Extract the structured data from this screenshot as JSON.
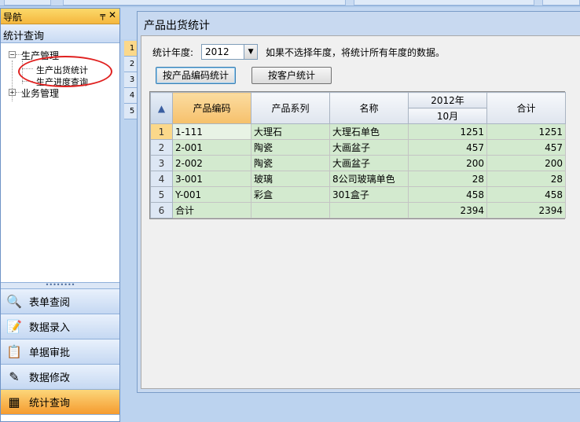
{
  "nav": {
    "title": "导航",
    "pin_icon": "pin-icon",
    "close_icon": "close-icon",
    "section": "统计查询",
    "tree": [
      {
        "label": "生产管理",
        "expanded": true,
        "children": [
          "生产出货统计",
          "生产进度查询"
        ]
      },
      {
        "label": "业务管理",
        "expanded": false,
        "children": []
      }
    ],
    "buttons": [
      {
        "label": "表单查阅",
        "icon": "search-doc-icon"
      },
      {
        "label": "数据录入",
        "icon": "data-entry-icon"
      },
      {
        "label": "单据审批",
        "icon": "approve-icon"
      },
      {
        "label": "数据修改",
        "icon": "edit-icon"
      },
      {
        "label": "统计查询",
        "icon": "table-icon",
        "active": true
      }
    ]
  },
  "background_rows": [
    "1",
    "2",
    "3",
    "4",
    "5"
  ],
  "dialog": {
    "title": "产品出货统计",
    "year_label": "统计年度:",
    "year_value": "2012",
    "hint": "如果不选择年度，将统计所有年度的数据。",
    "btn_by_code": "按产品编码统计",
    "btn_by_customer": "按客户统计"
  },
  "table": {
    "headers": {
      "code": "产品编码",
      "series": "产品系列",
      "name": "名称",
      "year_group": "2012年",
      "month": "10月",
      "total": "合计"
    },
    "rows": [
      {
        "n": "1",
        "code": "1-111",
        "series": "大理石",
        "name": "大理石单色",
        "month": "1251",
        "total": "1251"
      },
      {
        "n": "2",
        "code": "2-001",
        "series": "陶瓷",
        "name": "大画盆子",
        "month": "457",
        "total": "457"
      },
      {
        "n": "3",
        "code": "2-002",
        "series": "陶瓷",
        "name": "大画盆子",
        "month": "200",
        "total": "200"
      },
      {
        "n": "4",
        "code": "3-001",
        "series": "玻璃",
        "name": "8公司玻璃单色",
        "month": "28",
        "total": "28"
      },
      {
        "n": "5",
        "code": "Y-001",
        "series": "彩盒",
        "name": "301盒子",
        "month": "458",
        "total": "458"
      },
      {
        "n": "6",
        "code": "合计",
        "series": "",
        "name": "",
        "month": "2394",
        "total": "2394"
      }
    ]
  }
}
